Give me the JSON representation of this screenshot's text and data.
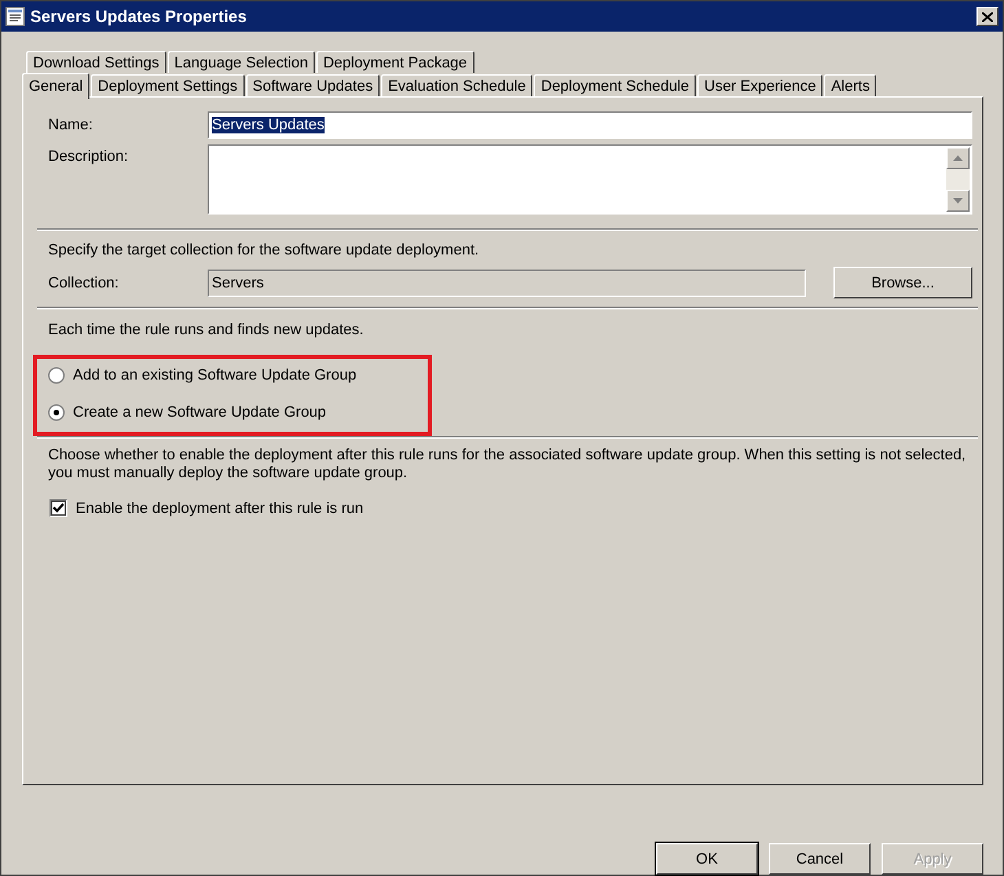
{
  "window": {
    "title": "Servers Updates Properties"
  },
  "tabs": {
    "back_row": [
      {
        "label": "Download Settings",
        "selected": false
      },
      {
        "label": "Language Selection",
        "selected": false
      },
      {
        "label": "Deployment Package",
        "selected": false
      }
    ],
    "front_row": [
      {
        "label": "General",
        "selected": true
      },
      {
        "label": "Deployment Settings",
        "selected": false
      },
      {
        "label": "Software Updates",
        "selected": false
      },
      {
        "label": "Evaluation Schedule",
        "selected": false
      },
      {
        "label": "Deployment Schedule",
        "selected": false
      },
      {
        "label": "User Experience",
        "selected": false
      },
      {
        "label": "Alerts",
        "selected": false
      }
    ]
  },
  "name": {
    "label": "Name:",
    "value": "Servers Updates"
  },
  "description": {
    "label": "Description:"
  },
  "collection_intro": "Specify the target collection for the software update deployment.",
  "collection": {
    "label": "Collection:",
    "value": "Servers",
    "button": "Browse..."
  },
  "group_intro": "Each time the rule runs and finds new updates.",
  "group_options": [
    {
      "label": "Add to an existing Software Update Group",
      "selected": false
    },
    {
      "label": "Create a new Software Update Group",
      "selected": true
    }
  ],
  "enable_intro": "Choose whether to enable the deployment after this rule runs for the associated software update group. When this setting is not selected, you must manually deploy the software update group.",
  "enable": {
    "label": "Enable the deployment after this rule is run",
    "checked": true
  },
  "buttons": [
    {
      "label": "OK",
      "default": true,
      "disabled": false
    },
    {
      "label": "Cancel",
      "default": false,
      "disabled": false
    },
    {
      "label": "Apply",
      "default": false,
      "disabled": true
    }
  ]
}
